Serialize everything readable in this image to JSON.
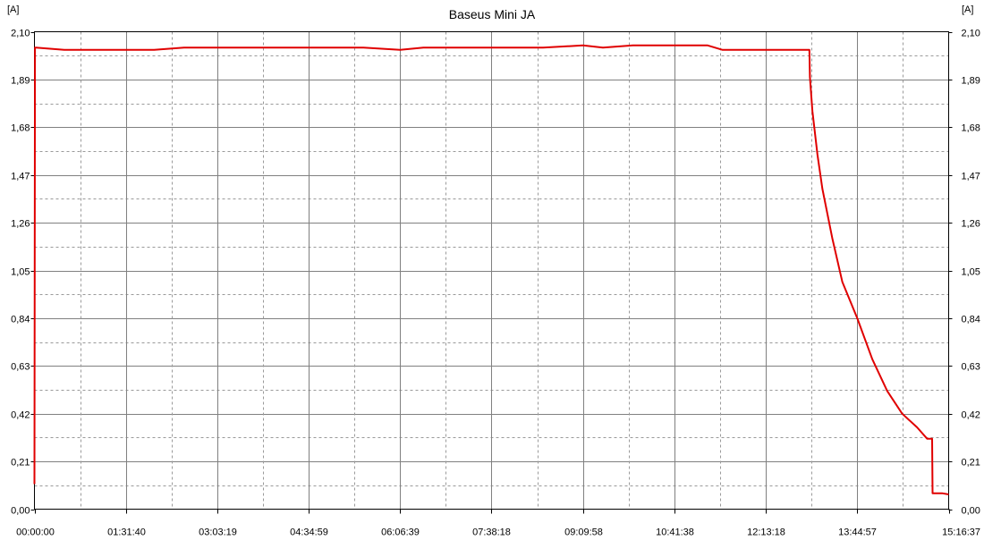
{
  "chart_data": {
    "type": "line",
    "title": "Baseus Mini JA",
    "y_unit_left": "[A]",
    "y_unit_right": "[A]",
    "ylim": [
      0,
      2.1
    ],
    "y_ticks": [
      {
        "value": 0.0,
        "label": "0,00"
      },
      {
        "value": 0.21,
        "label": "0,21"
      },
      {
        "value": 0.42,
        "label": "0,42"
      },
      {
        "value": 0.63,
        "label": "0,63"
      },
      {
        "value": 0.84,
        "label": "0,84"
      },
      {
        "value": 1.05,
        "label": "1,05"
      },
      {
        "value": 1.26,
        "label": "1,26"
      },
      {
        "value": 1.47,
        "label": "1,47"
      },
      {
        "value": 1.68,
        "label": "1,68"
      },
      {
        "value": 1.89,
        "label": "1,89"
      },
      {
        "value": 2.1,
        "label": "2,10"
      }
    ],
    "xlim": [
      "00:00:00",
      "15:16:37"
    ],
    "x_ticks": [
      "00:00:00",
      "01:31:40",
      "03:03:19",
      "04:34:59",
      "06:06:39",
      "07:38:18",
      "09:09:58",
      "10:41:38",
      "12:13:18",
      "13:44:57",
      "15:16:37"
    ],
    "grid": true,
    "colors": {
      "line": "#e00000",
      "grid_major": "#808080",
      "grid_minor": "#9a9a9a"
    },
    "series": [
      {
        "x": [
          "00:00:00",
          "00:00:30",
          "00:01:30",
          "00:30:00",
          "01:00:00",
          "01:31:40",
          "02:00:00",
          "02:30:00",
          "03:03:19",
          "03:30:00",
          "04:00:00",
          "04:34:59",
          "05:00:00",
          "05:30:00",
          "06:06:39",
          "06:30:00",
          "07:00:00",
          "07:38:18",
          "08:00:00",
          "08:30:00",
          "09:09:58",
          "09:30:00",
          "10:00:00",
          "10:20:00",
          "10:41:38",
          "11:00:00",
          "11:15:00",
          "11:30:00",
          "12:00:00",
          "12:13:18",
          "12:30:00",
          "12:57:00",
          "12:57:30",
          "13:00:00",
          "13:05:00",
          "13:10:00",
          "13:20:00",
          "13:30:00",
          "13:44:57",
          "14:00:00",
          "14:15:00",
          "14:30:00",
          "14:45:00",
          "14:55:00",
          "15:00:00",
          "15:00:30",
          "15:10:00",
          "15:16:37"
        ],
        "y": [
          0.11,
          2.03,
          2.03,
          2.02,
          2.02,
          2.02,
          2.02,
          2.03,
          2.03,
          2.03,
          2.03,
          2.03,
          2.03,
          2.03,
          2.02,
          2.03,
          2.03,
          2.03,
          2.03,
          2.03,
          2.04,
          2.03,
          2.04,
          2.04,
          2.04,
          2.04,
          2.04,
          2.02,
          2.02,
          2.02,
          2.02,
          2.02,
          1.9,
          1.75,
          1.56,
          1.41,
          1.19,
          1.0,
          0.84,
          0.66,
          0.52,
          0.42,
          0.36,
          0.31,
          0.31,
          0.07,
          0.07,
          0.065
        ]
      }
    ]
  }
}
